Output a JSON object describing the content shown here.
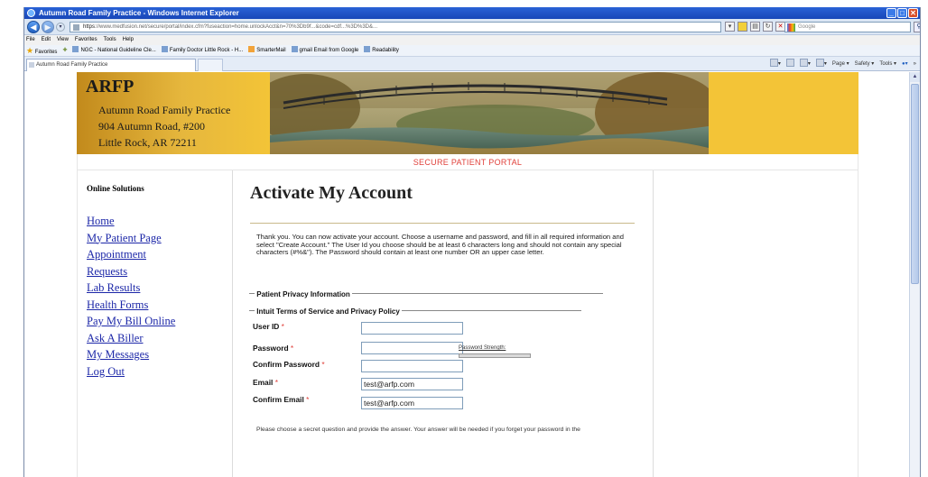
{
  "browser": {
    "window_title": "Autumn Road Family Practice - Windows Internet Explorer",
    "address_url_prefix": "https",
    "address_url": "://www.medfusion.net/secure/portal/index.cfm?fuseaction=home.unlockAcct&n=70%3Db9f...&code=cdf...%3D%3D&...",
    "search_placeholder": "Google",
    "menu": [
      "File",
      "Edit",
      "View",
      "Favorites",
      "Tools",
      "Help"
    ],
    "favorites_label": "Favorites",
    "favorites": [
      "NGC - National Guideline Cle...",
      "Family Doctor Little Rock - H...",
      "SmarterMail",
      "gmail Email from Google",
      "Readability"
    ],
    "tab_title": "Autumn Road Family Practice",
    "command_bar": [
      "Page",
      "Safety",
      "Tools"
    ]
  },
  "site": {
    "brand": "ARFP",
    "practice_name": "Autumn Road Family Practice",
    "address_line1": "904 Autumn Road, #200",
    "address_line2": "Little Rock, AR 72211",
    "portal_label": "SECURE PATIENT PORTAL"
  },
  "sidebar": {
    "heading": "Online Solutions",
    "links": [
      "Home",
      "My Patient Page",
      "Appointment",
      "Requests",
      "Lab Results",
      "Health Forms",
      "Pay My Bill Online",
      "Ask A Biller",
      "My Messages",
      "Log Out"
    ]
  },
  "main": {
    "title": "Activate My Account",
    "intro": "Thank you. You can now activate your account. Choose a username and password, and fill in all required information and select \"Create Account.\" The User Id you choose should be at least 6 characters long and should not contain any special characters (#%&\"). The Password should contain at least one number OR an upper case letter.",
    "section_privacy": "Patient Privacy Information",
    "section_terms": "Intuit Terms of Service and Privacy Policy",
    "fields": {
      "user_id": {
        "label": "User ID",
        "value": ""
      },
      "password": {
        "label": "Password",
        "value": ""
      },
      "confirm_password": {
        "label": "Confirm Password",
        "value": ""
      },
      "email": {
        "label": "Email",
        "value": "test@arfp.com"
      },
      "confirm_email": {
        "label": "Confirm Email",
        "value": "test@arfp.com"
      }
    },
    "required_mark": "*",
    "password_strength_label": "Password Strength:",
    "secret_question_text": "Please choose a secret question and provide the answer. Your answer will be needed if you forget your password in the"
  },
  "colors": {
    "header_gold": "#f3c437",
    "link_blue": "#1c27a8",
    "required_red": "#e0403a"
  }
}
